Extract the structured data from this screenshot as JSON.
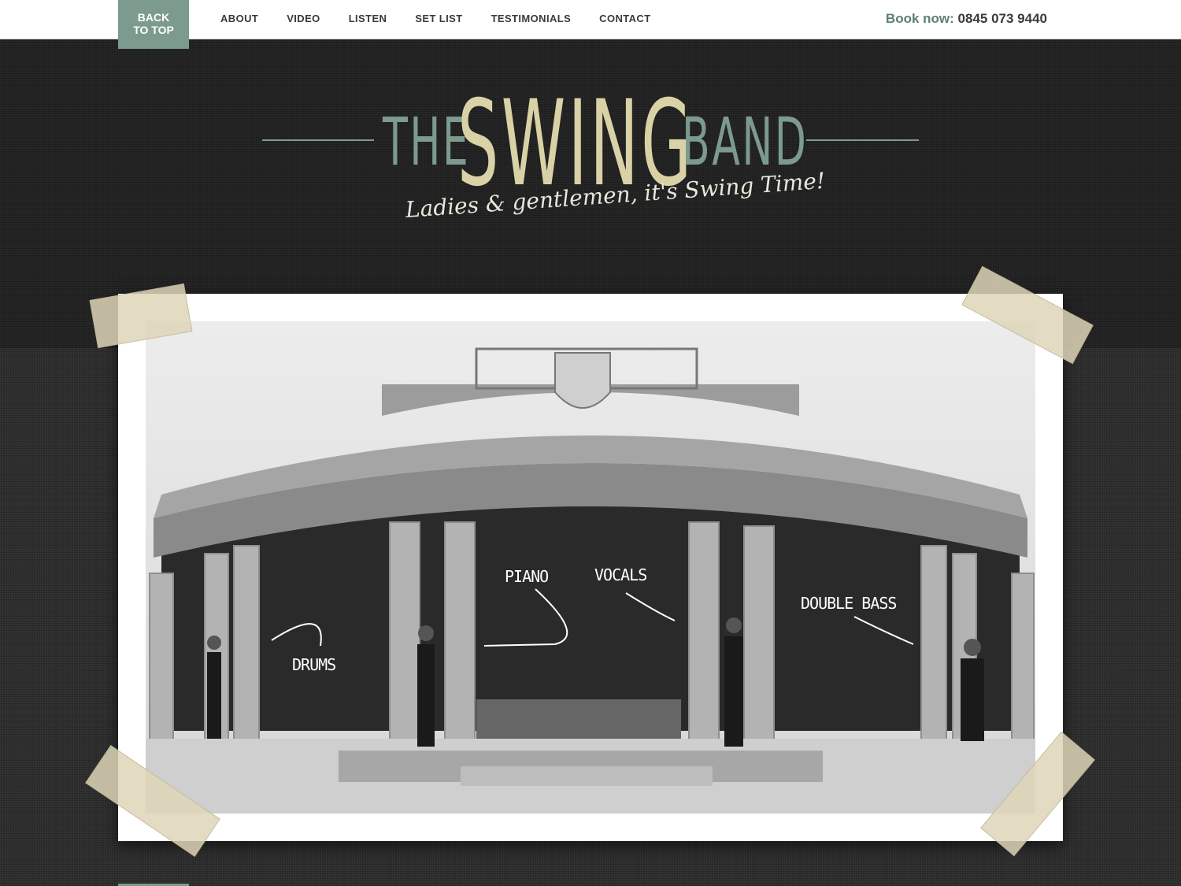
{
  "topbar": {
    "back_to_top": {
      "line1": "BACK",
      "line2": "TO TOP"
    },
    "nav": [
      "ABOUT",
      "VIDEO",
      "LISTEN",
      "SET LIST",
      "TESTIMONIALS",
      "CONTACT"
    ],
    "book_label": "Book now:",
    "book_number": "0845 073 9440"
  },
  "logo": {
    "the": "THE",
    "swing": "SWING",
    "band": "BAND",
    "tagline": "Ladies & gentlemen, it's Swing Time!"
  },
  "photo": {
    "annotations": [
      "PIANO",
      "VOCALS",
      "DOUBLE BASS",
      "DRUMS"
    ]
  },
  "colors": {
    "accent": "#7c9a8e",
    "cream": "#d9d2a6",
    "dark_bg": "#232323"
  }
}
